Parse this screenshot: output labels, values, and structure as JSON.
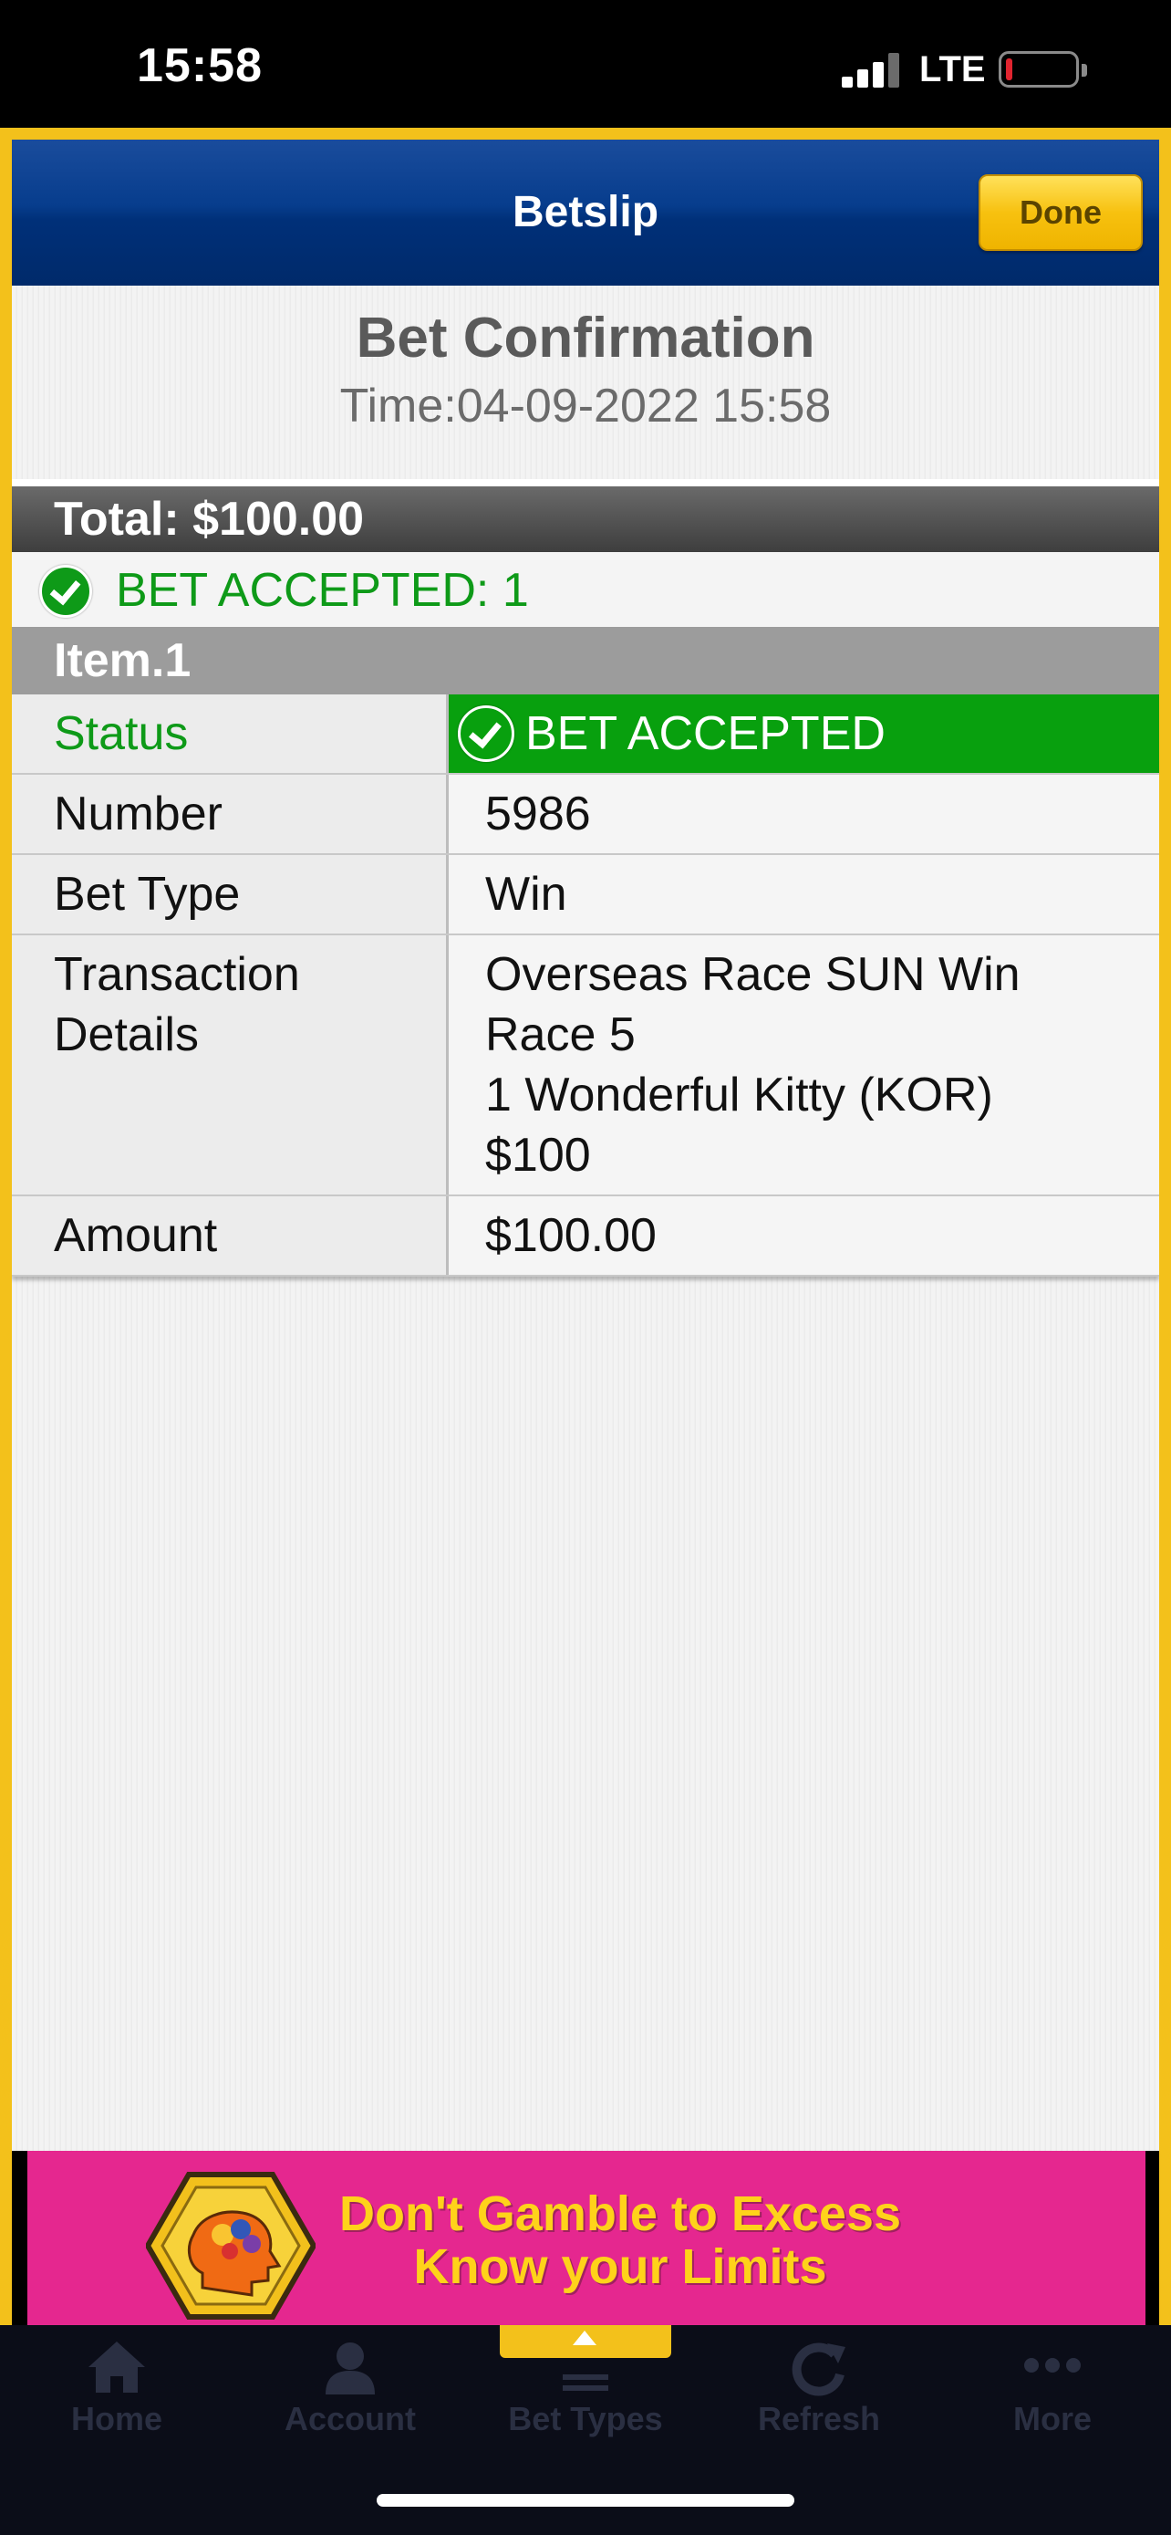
{
  "status_bar": {
    "time": "15:58",
    "network": "LTE",
    "battery_level": 0.1
  },
  "header": {
    "title": "Betslip",
    "done_label": "Done"
  },
  "confirmation": {
    "title": "Bet Confirmation",
    "time": "Time:04-09-2022 15:58"
  },
  "summary": {
    "total": "Total: $100.00",
    "accepted": "BET ACCEPTED: 1"
  },
  "item": {
    "title": "Item.1",
    "status_label": "Status",
    "status_value": "BET ACCEPTED",
    "number_label": "Number",
    "number_value": "5986",
    "bet_type_label": "Bet Type",
    "bet_type_value": "Win",
    "transaction_label_line1": "Transaction",
    "transaction_label_line2": "Details",
    "transaction_lines": [
      "Overseas Race SUN Win",
      "Race 5",
      "1 Wonderful Kitty (KOR)",
      "$100"
    ],
    "amount_label": "Amount",
    "amount_value": "$100.00"
  },
  "banner": {
    "line1": "Don't Gamble to Excess",
    "line2": "Know your Limits"
  },
  "tabs": [
    {
      "label": "Home",
      "icon": "home-icon"
    },
    {
      "label": "Account",
      "icon": "account-icon"
    },
    {
      "label": "Bet Types",
      "icon": "bet-types-icon"
    },
    {
      "label": "Refresh",
      "icon": "refresh-icon"
    },
    {
      "label": "More",
      "icon": "more-icon"
    }
  ],
  "colors": {
    "frame": "#f3c11b",
    "header": "#073d8d",
    "accepted_green": "#0e9a18",
    "banner_bg": "#e5278f",
    "banner_text": "#ffd21a"
  }
}
